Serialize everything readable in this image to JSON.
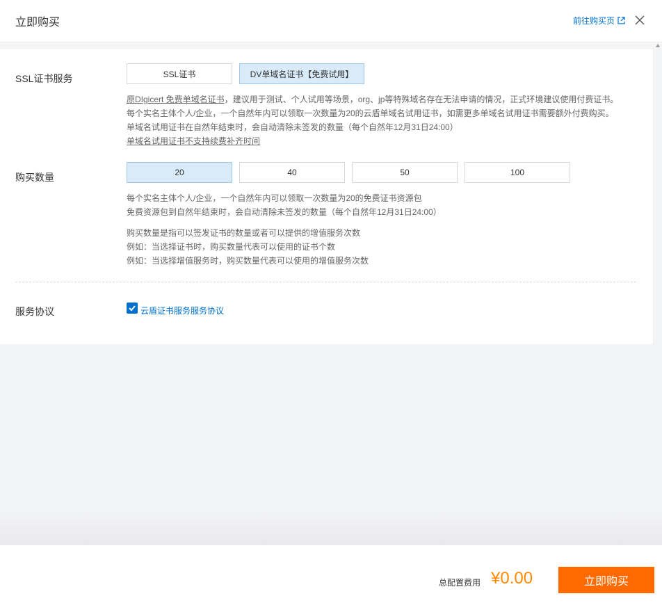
{
  "header": {
    "title": "立即购买",
    "goto_link": "前往购买页"
  },
  "ssl": {
    "label": "SSL证书服务",
    "options": [
      "SSL证书",
      "DV单域名证书【免费试用】"
    ],
    "selected": "DV单域名证书【免费试用】",
    "notes": {
      "line1_link": "原DIgicert 免费单域名证书",
      "line1_rest": "，建议用于测试、个人试用等场景，org、jp等特殊域名存在无法申请的情况，正式环境建议使用付费证书。",
      "line2": "每个实名主体个人/企业，一个自然年内可以领取一次数量为20的云盾单域名试用证书，如需更多单域名试用证书需要额外付费购买。",
      "line3": "单域名试用证书在自然年结束时，会自动清除未签发的数量（每个自然年12月31日24:00）",
      "line4": "单域名试用证书不支持续费补齐时间"
    }
  },
  "quantity": {
    "label": "购买数量",
    "options": [
      "20",
      "40",
      "50",
      "100"
    ],
    "selected": "20",
    "notes": [
      "每个实名主体个人/企业，一个自然年内可以领取一次数量为20的免费证书资源包",
      "免费资源包到自然年结束时，会自动清除未签发的数量（每个自然年12月31日24:00）",
      "购买数量是指可以签发证书的数量或者可以提供的增值服务次数",
      "例如：当选择证书时，购买数量代表可以使用的证书个数",
      "例如：当选择增值服务时，购买数量代表可以使用的增值服务次数"
    ]
  },
  "agreement": {
    "label": "服务协议",
    "checked": true,
    "link": "云盾证书服务服务协议"
  },
  "footer": {
    "total_label": "总配置费用",
    "price": "¥0.00",
    "buy_button": "立即购买"
  },
  "colors": {
    "accent": "#0070cc",
    "price": "#ff8a00",
    "buy": "#ff6a00",
    "selected_bg": "#d9ebf9"
  }
}
